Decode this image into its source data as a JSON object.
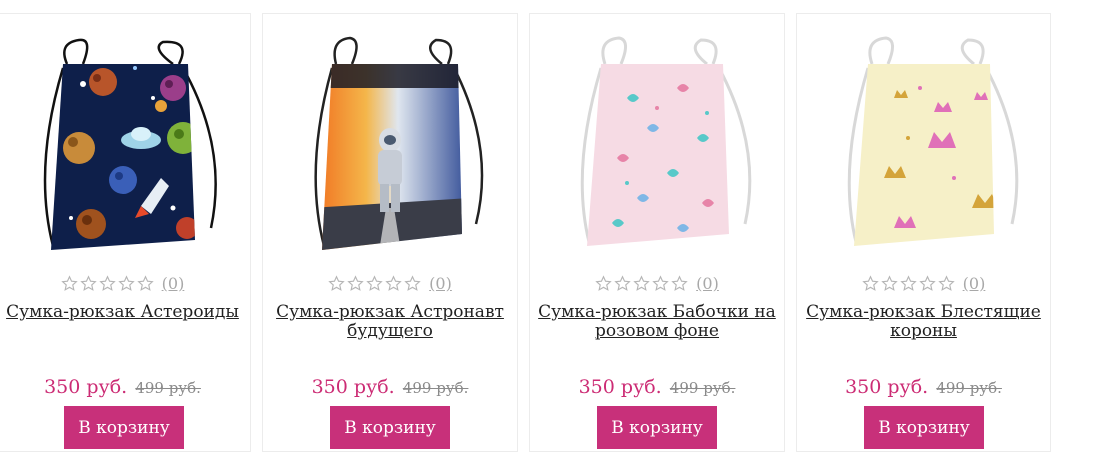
{
  "products": [
    {
      "name": "Сумка-рюкзак Астероиды",
      "reviews": "(0)",
      "price": "350 руб.",
      "old_price": "499 руб.",
      "button": "В корзину",
      "rating": 0,
      "image_theme": "space-asteroids",
      "colors": {
        "bag": "#0e1f4a",
        "accent": "#e8a23a"
      }
    },
    {
      "name": "Сумка-рюкзак Астронавт будущего",
      "reviews": "(0)",
      "price": "350 руб.",
      "old_price": "499 руб.",
      "button": "В корзину",
      "rating": 0,
      "image_theme": "astronaut",
      "colors": {
        "bag": "#3a4e86",
        "accent": "#e86a22"
      }
    },
    {
      "name": "Сумка-рюкзак Бабочки на розовом фоне",
      "reviews": "(0)",
      "price": "350 руб.",
      "old_price": "499 руб.",
      "button": "В корзину",
      "rating": 0,
      "image_theme": "butterflies-pink",
      "colors": {
        "bag": "#f6dbe4",
        "accent": "#58c9c9"
      }
    },
    {
      "name": "Сумка-рюкзак Блестящие короны",
      "reviews": "(0)",
      "price": "350 руб.",
      "old_price": "499 руб.",
      "button": "В корзину",
      "rating": 0,
      "image_theme": "glitter-crowns",
      "colors": {
        "bag": "#f6f0c8",
        "accent": "#e070b8"
      }
    }
  ],
  "theme": {
    "price_color": "#cc2b74",
    "button_color": "#c8307a",
    "star_color": "#b5b5b5"
  }
}
